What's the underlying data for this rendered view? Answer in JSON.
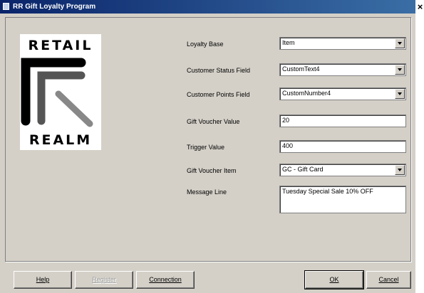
{
  "window": {
    "title": "RR Gift Loyalty Program",
    "close_glyph": "×"
  },
  "logo": {
    "top_text": "RETAIL",
    "bottom_text": "REALM"
  },
  "fields": {
    "loyalty_base": {
      "label": "Loyalty Base",
      "value": "Item"
    },
    "customer_status_field": {
      "label": "Customer Status Field",
      "value": "CustomText4"
    },
    "customer_points_field": {
      "label": "Customer Points Field",
      "value": "CustomNumber4"
    },
    "gift_voucher_value": {
      "label": "Gift Voucher Value",
      "value": "20"
    },
    "trigger_value": {
      "label": "Trigger Value",
      "value": "400"
    },
    "gift_voucher_item": {
      "label": "Gift Voucher Item",
      "value": "GC - Gift Card"
    },
    "message_line": {
      "label": "Message Line",
      "value": "Tuesday Special Sale 10% OFF"
    }
  },
  "buttons": {
    "help": "Help",
    "register": "Register",
    "connection": "Connection",
    "ok": "OK",
    "cancel": "Cancel"
  },
  "colors": {
    "titlebar_start": "#0a246a",
    "titlebar_end": "#3a6ea5",
    "dialog_bg": "#d4d0c8"
  }
}
